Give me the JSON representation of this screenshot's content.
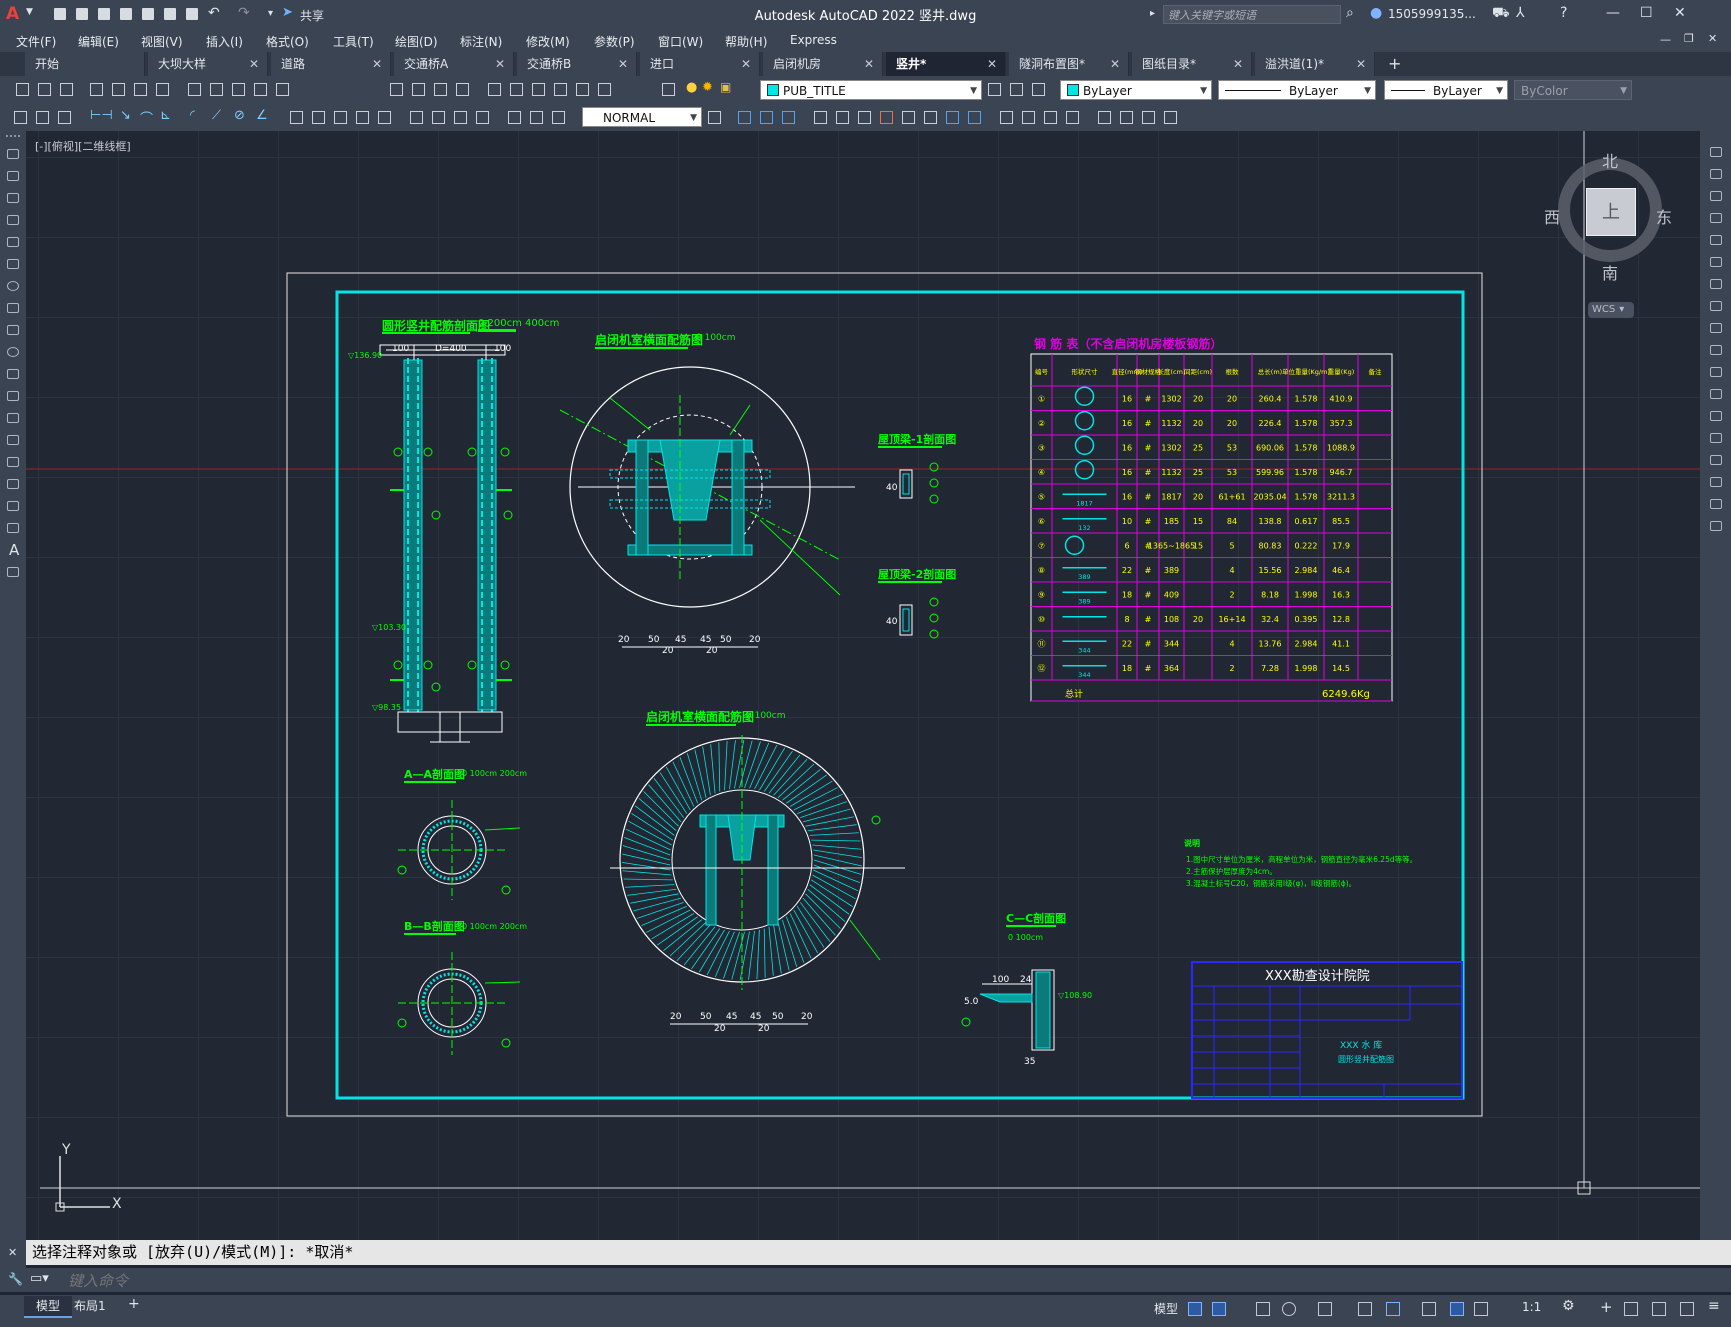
{
  "app": {
    "title": "Autodesk AutoCAD 2022    竖井.dwg",
    "share_label": "共享",
    "search_placeholder": "键入关键字或短语",
    "user": "1505999135...",
    "logo_letter": "A"
  },
  "menu": [
    "文件(F)",
    "编辑(E)",
    "视图(V)",
    "插入(I)",
    "格式(O)",
    "工具(T)",
    "绘图(D)",
    "标注(N)",
    "修改(M)",
    "参数(P)",
    "窗口(W)",
    "帮助(H)",
    "Express"
  ],
  "tabs": [
    {
      "label": "开始",
      "closable": false
    },
    {
      "label": "大坝大样",
      "closable": true
    },
    {
      "label": "道路",
      "closable": true
    },
    {
      "label": "交通桥A",
      "closable": true
    },
    {
      "label": "交通桥B",
      "closable": true
    },
    {
      "label": "进口",
      "closable": true
    },
    {
      "label": "启闭机房",
      "closable": true
    },
    {
      "label": "竖井*",
      "closable": true,
      "active": true
    },
    {
      "label": "隧洞布置图*",
      "closable": true
    },
    {
      "label": "图纸目录*",
      "closable": true
    },
    {
      "label": "溢洪道(1)*",
      "closable": true
    }
  ],
  "properties": {
    "layer": "PUB_TITLE",
    "color": "ByLayer",
    "linetype": "ByLayer",
    "lineweight": "ByLayer",
    "plotstyle": "ByColor",
    "dimstyle": "NORMAL"
  },
  "viewport": {
    "label": "[-][俯视][二维线框]",
    "compass": {
      "north": "北",
      "south": "南",
      "east": "东",
      "west": "西",
      "cube_face": "上"
    },
    "wcs": "WCS",
    "ucs_x": "X",
    "ucs_y": "Y"
  },
  "drawing": {
    "titles": {
      "main_section": "圆形竖井配筋剖面图",
      "house_plan": "启闭机室横面配筋图",
      "house_bottom": "启闭机室横面配筋图",
      "aa": "A—A剖面图",
      "bb": "B—B剖面图",
      "cc": "C—C剖面图",
      "beam1": "屋顶梁-1剖面图",
      "beam2": "屋顶梁-2剖面图",
      "scale_200": "0 200cm 400cm",
      "scale_100": "0 100cm",
      "scale_100_200": "0 100cm 200cm"
    },
    "dims": {
      "top_row": [
        "100",
        "D=400",
        "100"
      ],
      "levels": [
        "▽136.90",
        "▽103.30",
        "▽98.35",
        "▽108.90"
      ],
      "bottom_row": [
        "20",
        "50",
        "45",
        "45",
        "50",
        "20"
      ],
      "bottom_sub": [
        "20",
        "20"
      ],
      "cc_dims": [
        "100",
        "24",
        "35",
        "5.0"
      ],
      "beam_dim": "40"
    },
    "rebar_table": {
      "title": "钢 筋 表（不含启闭机房楼板钢筋）",
      "headers": [
        "编号",
        "形状尺寸",
        "直径(mm)",
        "钢材规格",
        "长度(cm)",
        "间距(cm)",
        "根数",
        "总长(m)",
        "单位重量(Kg/m)",
        "重量(Kg)",
        "备注"
      ],
      "rows": [
        [
          "①",
          "",
          "16",
          "#",
          "1302",
          "20",
          "20",
          "260.4",
          "1.578",
          "410.9"
        ],
        [
          "②",
          "",
          "16",
          "#",
          "1132",
          "20",
          "20",
          "226.4",
          "1.578",
          "357.3"
        ],
        [
          "③",
          "",
          "16",
          "#",
          "1302",
          "25",
          "53",
          "690.06",
          "1.578",
          "1088.9"
        ],
        [
          "④",
          "",
          "16",
          "#",
          "1132",
          "25",
          "53",
          "599.96",
          "1.578",
          "946.7"
        ],
        [
          "⑤",
          "1817",
          "16",
          "#",
          "1817",
          "20",
          "61+61",
          "2035.04",
          "1.578",
          "3211.3"
        ],
        [
          "⑥",
          "132",
          "10",
          "#",
          "185",
          "15",
          "84",
          "138.8",
          "0.617",
          "85.5"
        ],
        [
          "⑦",
          "",
          "6",
          "#",
          "1365~1865",
          "15",
          "5",
          "80.83",
          "0.222",
          "17.9"
        ],
        [
          "⑧",
          "389",
          "22",
          "#",
          "389",
          "",
          "4",
          "15.56",
          "2.984",
          "46.4"
        ],
        [
          "⑨",
          "389",
          "18",
          "#",
          "409",
          "",
          "2",
          "8.18",
          "1.998",
          "16.3"
        ],
        [
          "⑩",
          "",
          "8",
          "#",
          "108",
          "20",
          "16+14",
          "32.4",
          "0.395",
          "12.8"
        ],
        [
          "⑪",
          "344",
          "22",
          "#",
          "344",
          "",
          "4",
          "13.76",
          "2.984",
          "41.1"
        ],
        [
          "⑫",
          "344",
          "18",
          "#",
          "364",
          "",
          "2",
          "7.28",
          "1.998",
          "14.5"
        ]
      ],
      "total_label": "总计",
      "total_value": "6249.6Kg"
    },
    "notes": {
      "title": "说明",
      "lines": [
        "1.图中尺寸单位为厘米，高程单位为米，钢筋直径为毫米6.25d等等。",
        "2.主筋保护层厚度为4cm。",
        "3.混凝土标号C20，钢筋采用I级(φ)，II级钢筋(ɸ)。"
      ]
    },
    "title_block": {
      "institute": "XXX勘查设计院院",
      "project": "XXX 水 库",
      "drawing_name": "圆形竖井配筋图"
    }
  },
  "command": {
    "history": "选择注释对象或 [放弃(U)/模式(M)]: *取消*",
    "placeholder": "键入命令"
  },
  "layouts": [
    "模型",
    "布局1"
  ],
  "status": {
    "model_label": "模型",
    "scale": "1:1"
  },
  "colors": {
    "frame": "#00e5e5",
    "table_grid": "#e000e0",
    "title_green": "#00ff00",
    "title_block_blue": "#2a2aff",
    "rebar": "#00e5e5",
    "text_yellow": "#ffff00"
  }
}
